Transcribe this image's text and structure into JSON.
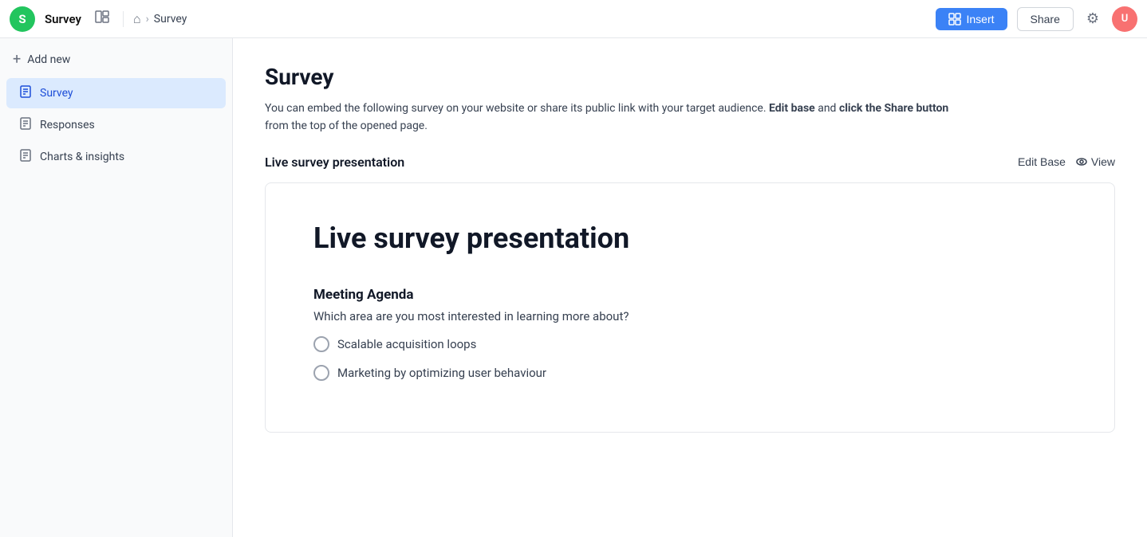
{
  "app": {
    "logo_letter": "S",
    "name": "Survey"
  },
  "topnav": {
    "breadcrumb_home": "🏠",
    "breadcrumb_sep": ">",
    "breadcrumb_current": "Survey",
    "insert_label": "Insert",
    "share_label": "Share"
  },
  "sidebar": {
    "add_new_label": "Add new",
    "items": [
      {
        "id": "survey",
        "label": "Survey",
        "active": true
      },
      {
        "id": "responses",
        "label": "Responses",
        "active": false
      },
      {
        "id": "charts",
        "label": "Charts & insights",
        "active": false
      }
    ]
  },
  "page": {
    "title": "Survey",
    "description_start": "You can embed the following survey on your website or share its public link with your target audience.",
    "description_edit_base": "Edit base",
    "description_mid": "and",
    "description_click": "click the Share button",
    "description_end": "from the top of the opened page.",
    "section_title": "Live survey presentation",
    "edit_base_label": "Edit Base",
    "view_label": "View"
  },
  "survey_card": {
    "title": "Live survey presentation",
    "section_label": "Meeting Agenda",
    "question": "Which area are you most interested in learning more about?",
    "options": [
      {
        "id": "opt1",
        "label": "Scalable acquisition loops"
      },
      {
        "id": "opt2",
        "label": "Marketing by optimizing user behaviour"
      }
    ]
  }
}
